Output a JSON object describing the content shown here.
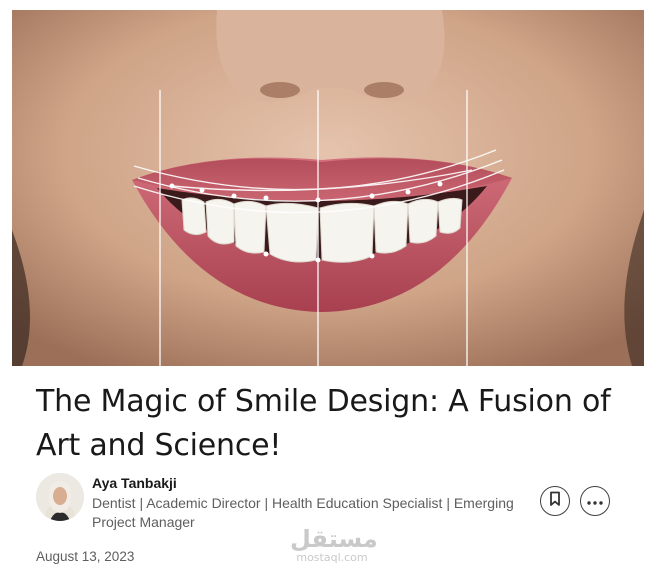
{
  "article": {
    "title": "The Magic of Smile Design: A Fusion of Art and Science!",
    "date": "August 13, 2023"
  },
  "author": {
    "name": "Aya Tanbakji",
    "headline": "Dentist | Academic Director | Health Education Specialist | Emerging Project Manager"
  },
  "actions": {
    "save_icon": "bookmark-icon",
    "more_icon": "ellipsis-icon"
  },
  "watermark": {
    "arabic": "مستقل",
    "latin": "mostaql.com"
  },
  "colors": {
    "title": "#191919",
    "secondary_text": "#5e5e5e",
    "skin": "#caa187",
    "lips": "#b94e5c"
  }
}
